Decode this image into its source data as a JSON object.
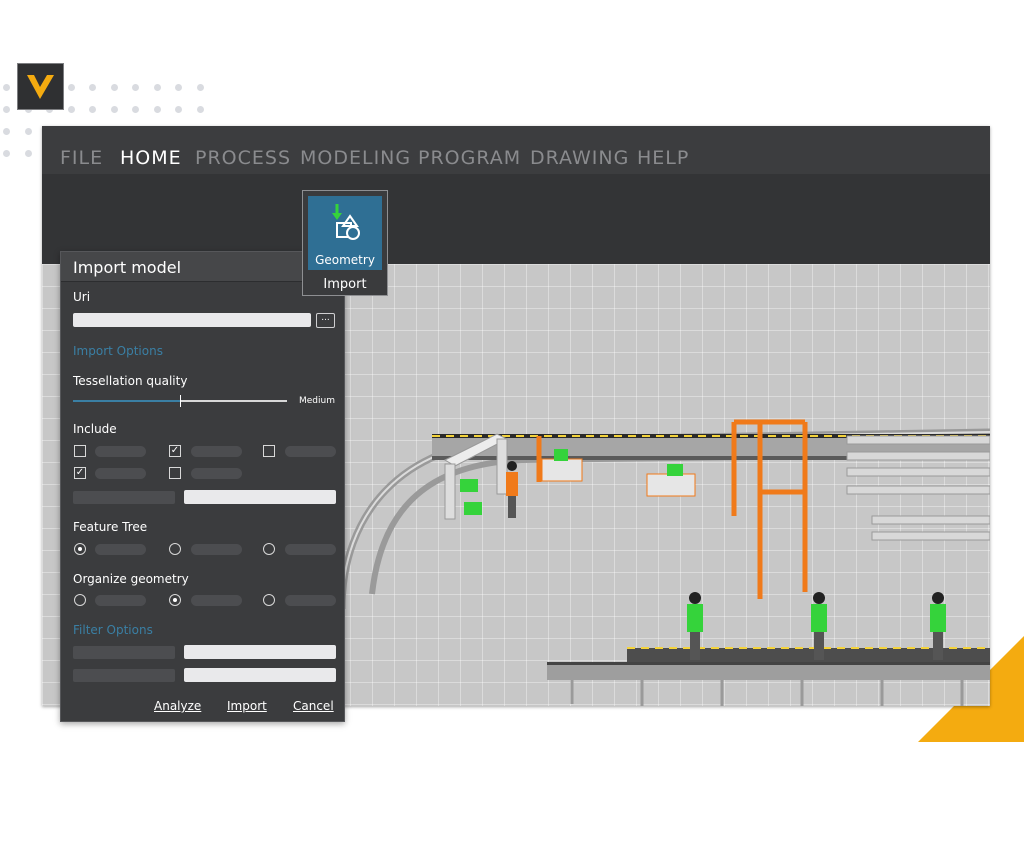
{
  "menu": {
    "items": [
      {
        "label": "FILE",
        "active": false
      },
      {
        "label": "HOME",
        "active": true
      },
      {
        "label": "PROCESS",
        "active": false
      },
      {
        "label": "MODELING",
        "active": false
      },
      {
        "label": "PROGRAM",
        "active": false
      },
      {
        "label": "DRAWING",
        "active": false
      },
      {
        "label": "HELP",
        "active": false
      }
    ]
  },
  "ribbon": {
    "geometry_label": "Geometry",
    "import_label": "Import",
    "geometry_icon": "import-geometry-icon",
    "logo_icon": "visual-components-logo"
  },
  "dialog": {
    "title": "Import model",
    "uri_label": "Uri",
    "uri_value": "",
    "browse_label": "...",
    "import_options_label": "Import Options",
    "tessellation_label": "Tessellation quality",
    "tessellation_value_label": "Medium",
    "tessellation_level": 0.5,
    "include_label": "Include",
    "include_checks": [
      false,
      true,
      false,
      true,
      false
    ],
    "feature_tree_label": "Feature Tree",
    "feature_tree_selected": 0,
    "organize_geometry_label": "Organize geometry",
    "organize_geometry_selected": 1,
    "filter_options_label": "Filter Options",
    "buttons": {
      "analyze": "Analyze",
      "import": "Import",
      "cancel": "Cancel"
    }
  },
  "colors": {
    "accent_blue": "#2f6f94",
    "section_blue": "#3a7fa4",
    "brand_yellow": "#f4ab10",
    "robot_orange": "#f07a1a",
    "worker_green": "#35d33b",
    "selection_cyan": "#8ee6ff"
  }
}
